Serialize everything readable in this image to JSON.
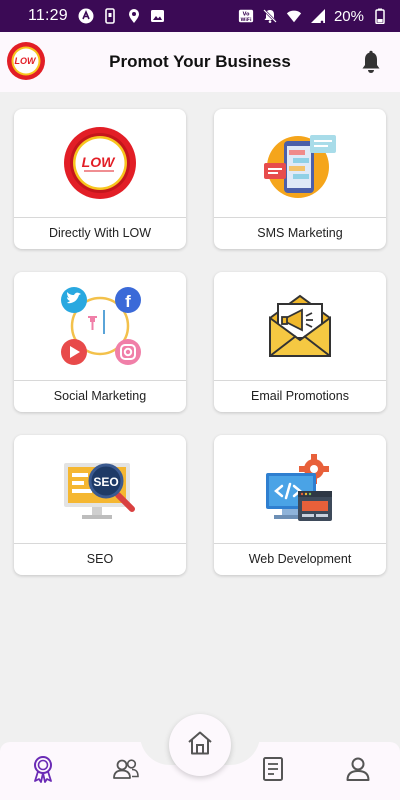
{
  "status_bar": {
    "time": "11:29",
    "battery": "20%",
    "icons_left": [
      "app-a-icon",
      "phone-icon",
      "location-icon",
      "image-icon"
    ],
    "icons_right": [
      "volte-wifi-icon",
      "mute-icon",
      "wifi-icon",
      "signal-icon",
      "battery-icon"
    ]
  },
  "app_bar": {
    "title": "Promot Your Business",
    "logo_text": "LOW",
    "notification_icon": "bell-icon"
  },
  "cards": [
    {
      "label": "Directly With LOW",
      "icon": "low-logo-icon"
    },
    {
      "label": "SMS Marketing",
      "icon": "sms-marketing-icon"
    },
    {
      "label": "Social Marketing",
      "icon": "social-marketing-icon"
    },
    {
      "label": "Email Promotions",
      "icon": "email-promotion-icon"
    },
    {
      "label": "SEO",
      "icon": "seo-icon"
    },
    {
      "label": "Web Development",
      "icon": "web-development-icon"
    }
  ],
  "seo_badge_text": "SEO",
  "bottom_nav": {
    "items": [
      "award-icon",
      "users-icon",
      "home-icon",
      "document-icon",
      "profile-icon"
    ],
    "active": "award-icon",
    "colors": {
      "active": "#6a2bb5",
      "inactive": "#555555"
    }
  },
  "colors": {
    "status_bar": "#3b0a55",
    "app_bar": "#fdf8fd",
    "background": "#f0f0f0",
    "brand_red": "#e21e26"
  }
}
